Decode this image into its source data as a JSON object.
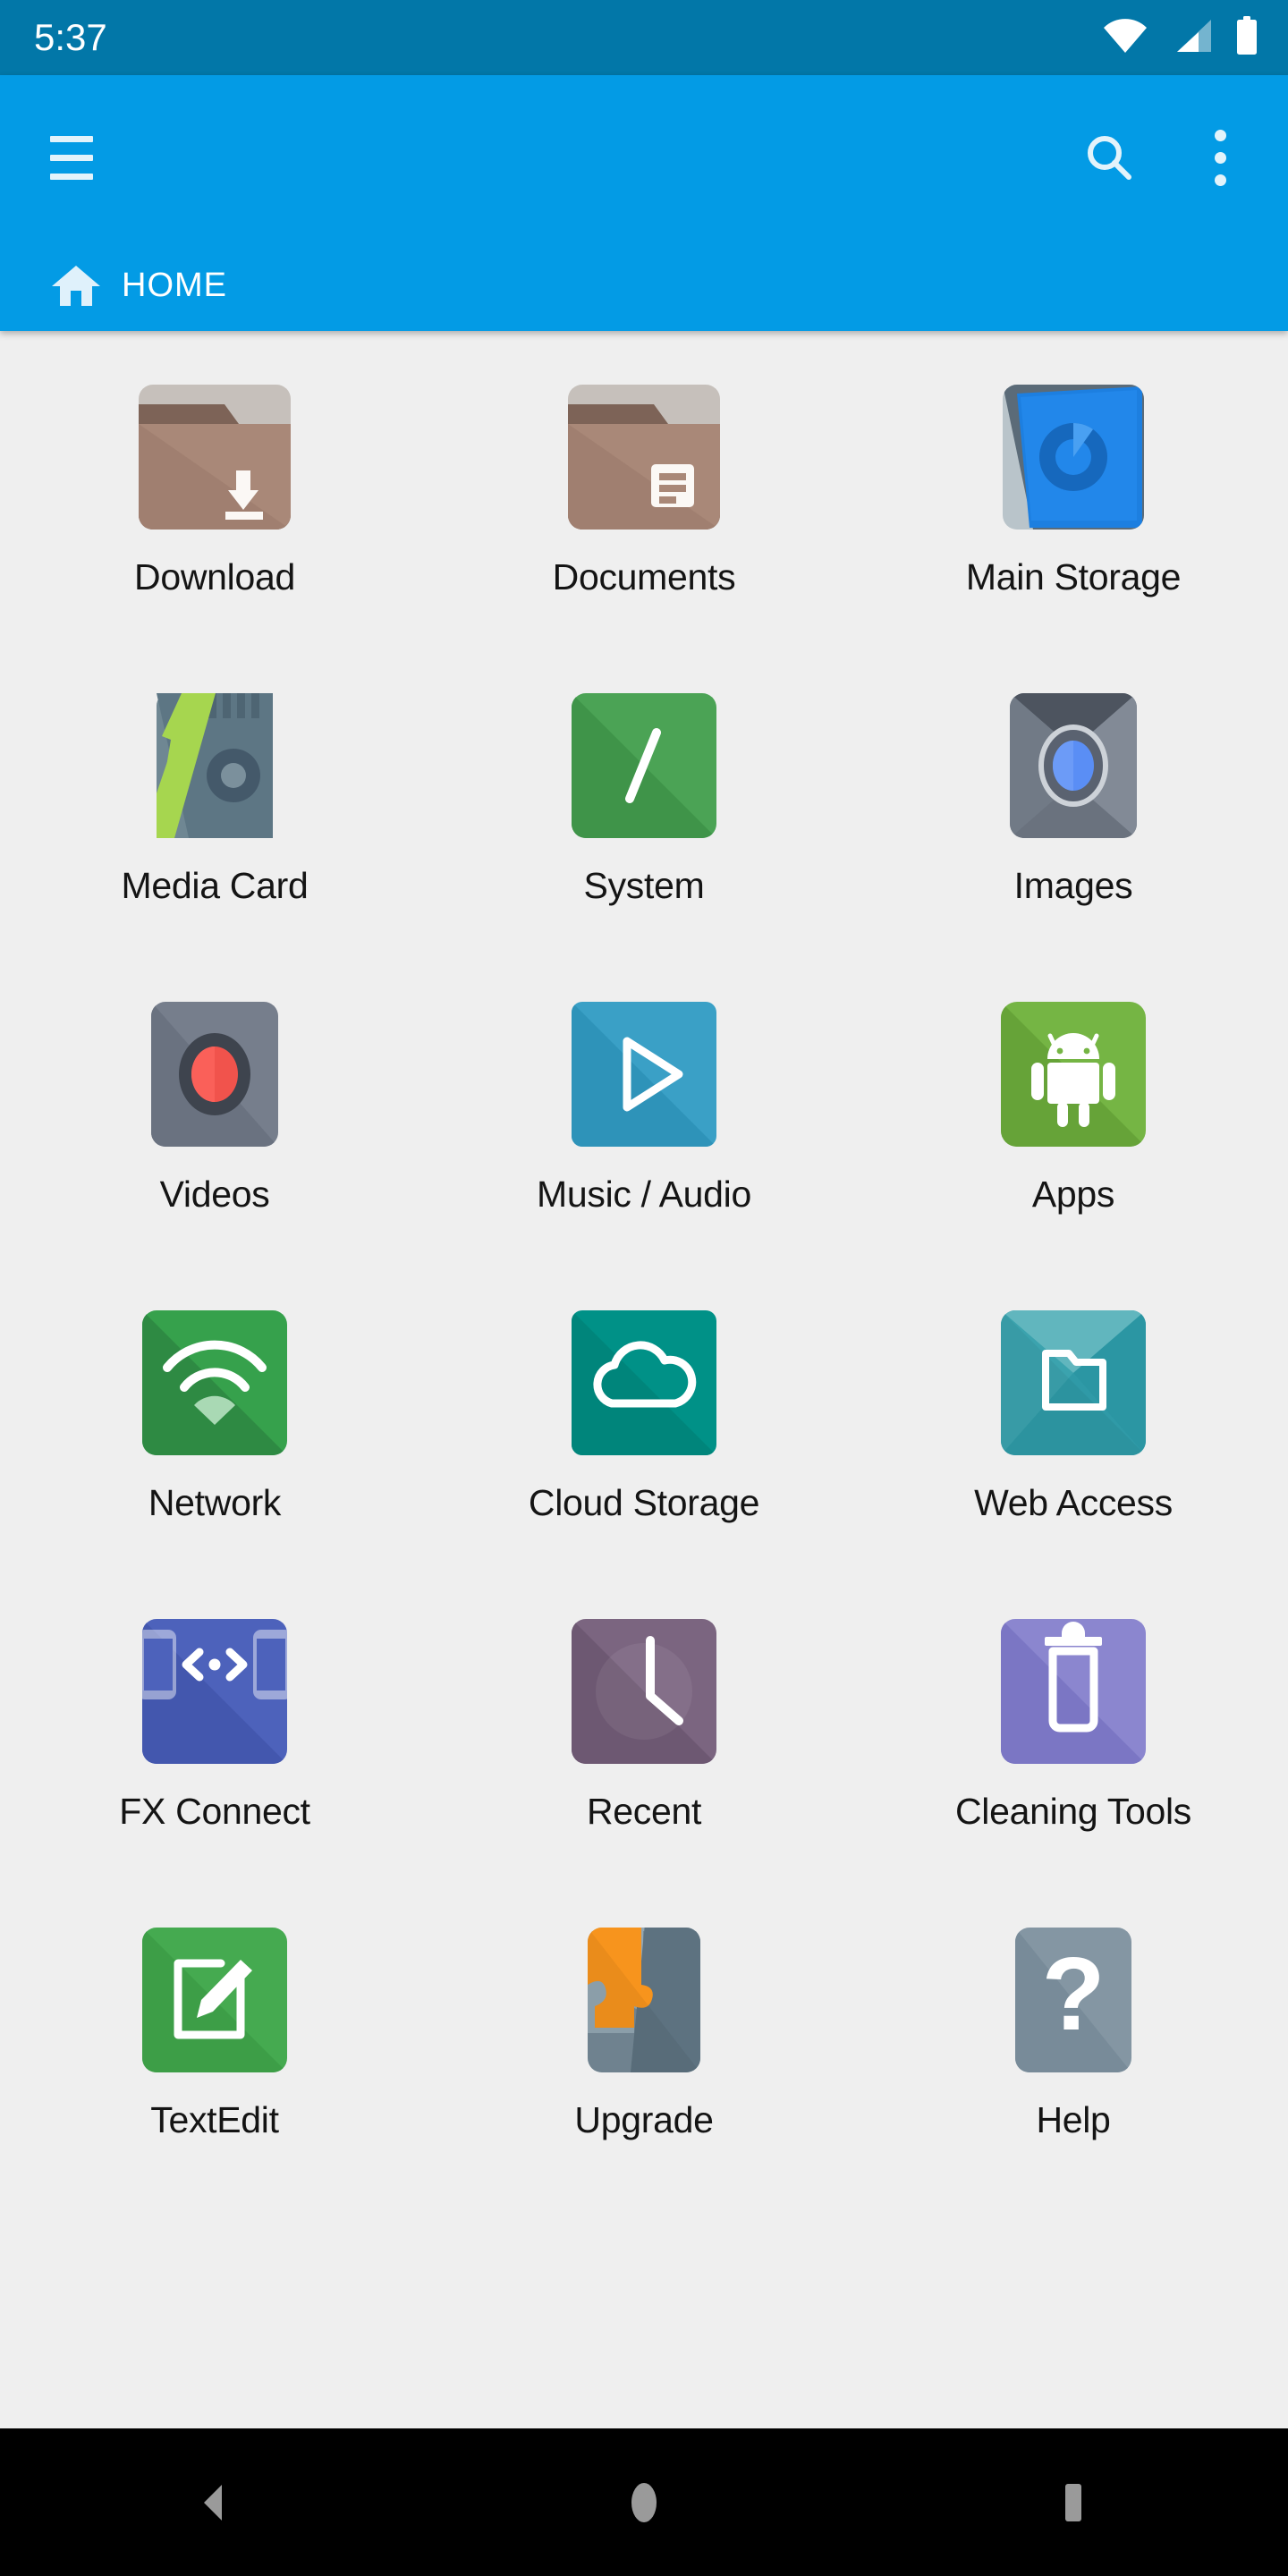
{
  "status_bar": {
    "time": "5:37",
    "icons": [
      "wifi-icon",
      "cellular-signal-icon",
      "battery-icon"
    ],
    "background_color": "#0277a8"
  },
  "app_bar": {
    "background_color": "#039be5",
    "menu_icon": "hamburger-menu-icon",
    "search_icon": "search-icon",
    "overflow_icon": "overflow-menu-icon",
    "breadcrumb": {
      "icon": "home-icon",
      "label": "HOME"
    }
  },
  "content": {
    "background_color": "#efefef",
    "columns": 3,
    "items": [
      {
        "label": "Download",
        "icon": "folder-download-icon",
        "color": "#a3806f"
      },
      {
        "label": "Documents",
        "icon": "folder-documents-icon",
        "color": "#a3806f"
      },
      {
        "label": "Main Storage",
        "icon": "internal-storage-icon",
        "color": "#1f7ee0"
      },
      {
        "label": "Media Card",
        "icon": "sd-card-icon",
        "color": "#6d8490"
      },
      {
        "label": "System",
        "icon": "root-slash-icon",
        "color": "#359342"
      },
      {
        "label": "Images",
        "icon": "camera-lens-icon",
        "color": "#6e7684"
      },
      {
        "label": "Videos",
        "icon": "video-record-icon",
        "color": "#6b7382"
      },
      {
        "label": "Music / Audio",
        "icon": "play-triangle-icon",
        "color": "#2b93b9"
      },
      {
        "label": "Apps",
        "icon": "android-robot-icon",
        "color": "#6aa83c"
      },
      {
        "label": "Network",
        "icon": "wifi-network-icon",
        "color": "#2e8a43"
      },
      {
        "label": "Cloud Storage",
        "icon": "cloud-icon",
        "color": "#00857b"
      },
      {
        "label": "Web Access",
        "icon": "web-folder-icon",
        "color": "#2c9aa6"
      },
      {
        "label": "FX Connect",
        "icon": "device-connect-icon",
        "color": "#4659b0"
      },
      {
        "label": "Recent",
        "icon": "clock-icon",
        "color": "#6f5a72"
      },
      {
        "label": "Cleaning Tools",
        "icon": "trash-icon",
        "color": "#7b76c4"
      },
      {
        "label": "TextEdit",
        "icon": "pencil-edit-icon",
        "color": "#3d9e47"
      },
      {
        "label": "Upgrade",
        "icon": "puzzle-piece-icon",
        "color": "#7b94a3"
      },
      {
        "label": "Help",
        "icon": "question-mark-icon",
        "color": "#7b8c99"
      }
    ]
  },
  "nav_bar": {
    "background_color": "#000000",
    "buttons": [
      {
        "name": "back-button",
        "icon": "back-triangle-icon"
      },
      {
        "name": "home-button",
        "icon": "home-circle-icon"
      },
      {
        "name": "recents-button",
        "icon": "recents-square-icon"
      }
    ]
  }
}
